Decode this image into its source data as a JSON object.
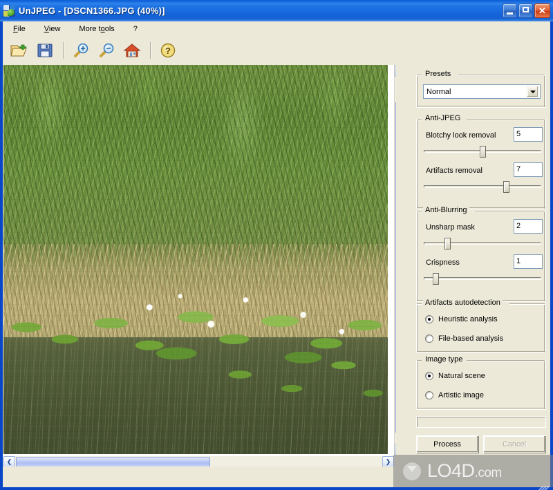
{
  "window": {
    "app_name": "UnJPEG",
    "title": "UnJPEG - [DSCN1366.JPG (40%)]",
    "document_name": "DSCN1366.JPG",
    "zoom_level": "40%",
    "app_icon": "unjpeg-app-icon",
    "caption_buttons": [
      {
        "name": "minimize",
        "glyph": "_"
      },
      {
        "name": "maximize",
        "glyph": "□"
      },
      {
        "name": "close",
        "glyph": "×"
      }
    ]
  },
  "menubar": {
    "items": [
      {
        "label": "File",
        "accel_prefix": "F",
        "accel_rest": "ile"
      },
      {
        "label": "View",
        "accel_prefix": "V",
        "accel_rest": "iew"
      },
      {
        "label": "More tools",
        "accel_prefix": "More t",
        "accel_rest": "ools"
      },
      {
        "label": "?",
        "accel_prefix": "?",
        "accel_rest": ""
      }
    ]
  },
  "toolbar": {
    "buttons": [
      {
        "name": "open-icon",
        "tooltip": "Open"
      },
      {
        "name": "save-icon",
        "tooltip": "Save"
      },
      {
        "name": "zoom-in-icon",
        "tooltip": "Zoom in"
      },
      {
        "name": "zoom-out-icon",
        "tooltip": "Zoom out"
      },
      {
        "name": "home-icon",
        "tooltip": "Home"
      },
      {
        "name": "help-icon",
        "tooltip": "Help"
      }
    ]
  },
  "image_view": {
    "photo_description": "Pond with green reeds, dry tan reeds, lily pads and white water lilies",
    "vscroll": {
      "up_glyph": "▲",
      "down_glyph": "▼"
    },
    "hscroll": {
      "left_glyph": "❮",
      "right_glyph": "❯"
    }
  },
  "panel": {
    "presets": {
      "title": "Presets",
      "selected": "Normal",
      "options": [
        "Normal"
      ]
    },
    "anti_jpeg": {
      "title": "Anti-JPEG",
      "controls": [
        {
          "label": "Blotchy look removal",
          "value": "5",
          "percent": 50
        },
        {
          "label": "Artifacts removal",
          "value": "7",
          "percent": 70
        }
      ]
    },
    "anti_blurring": {
      "title": "Anti-Blurring",
      "controls": [
        {
          "label": "Unsharp mask",
          "value": "2",
          "percent": 20
        },
        {
          "label": "Crispness",
          "value": "1",
          "percent": 10
        }
      ]
    },
    "artifacts_autodetection": {
      "title": "Artifacts autodetection",
      "options": [
        {
          "label": "Heuristic analysis",
          "selected": true
        },
        {
          "label": "File-based analysis",
          "selected": false
        }
      ]
    },
    "image_type": {
      "title": "Image type",
      "options": [
        {
          "label": "Natural scene",
          "selected": true
        },
        {
          "label": "Artistic image",
          "selected": false
        }
      ]
    },
    "progress": {
      "value": ""
    },
    "actions": {
      "process_label": "Process",
      "cancel_label": "Cancel",
      "cancel_disabled": true
    }
  },
  "watermark": {
    "brand": "LO4D",
    "suffix": ".com"
  },
  "colors": {
    "titlebar_blue": "#1463d8",
    "frame_blue": "#0a46c8",
    "face": "#ece9d8",
    "field_border": "#7f9db9",
    "groupbox_line": "#aca899",
    "close_red": "#cd3d16"
  }
}
